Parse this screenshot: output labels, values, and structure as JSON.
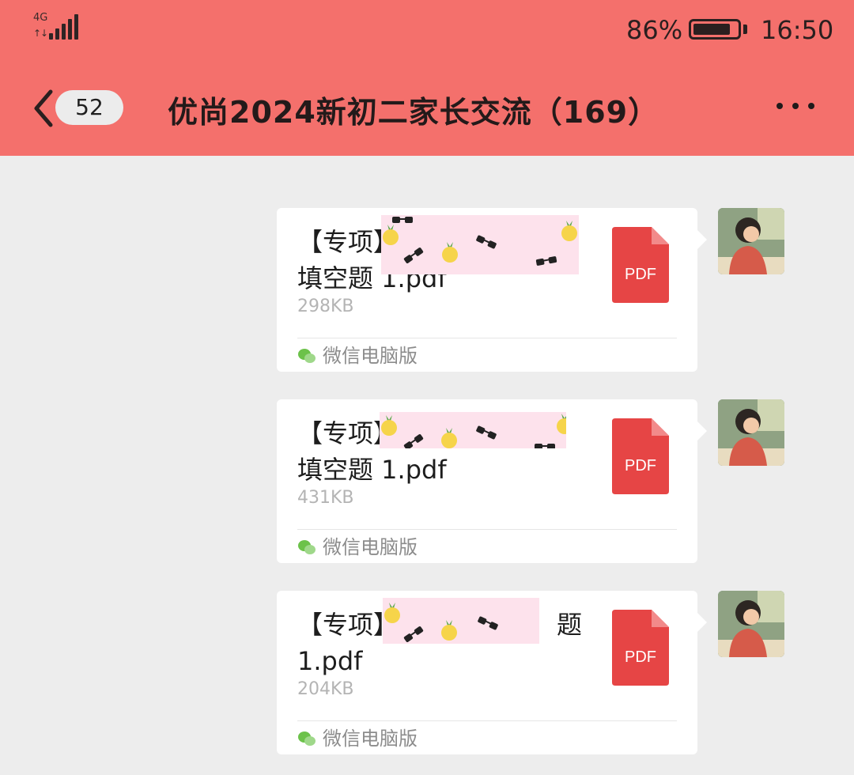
{
  "status_bar": {
    "network": "4G",
    "battery_percent": "86%",
    "battery_level": 0.86,
    "time": "16:50"
  },
  "nav": {
    "unread_count": "52",
    "title": "优尚2024新初二家长交流（169）"
  },
  "messages": [
    {
      "name_line1": "【专项】",
      "name_line2": "填空题 1.pdf",
      "size": "298KB",
      "source": "微信电脑版",
      "file_type": "PDF"
    },
    {
      "name_line1": "【专项】",
      "name_line2": "填空题 1.pdf",
      "size": "431KB",
      "source": "微信电脑版",
      "file_type": "PDF"
    },
    {
      "name_line1": "【专项】",
      "name_line1_tail": "题",
      "name_line2": "1.pdf",
      "size": "204KB",
      "source": "微信电脑版",
      "file_type": "PDF"
    }
  ],
  "colors": {
    "header_bg": "#f4706c",
    "chat_bg": "#ededed",
    "pdf_red": "#e64545",
    "redaction_pink": "#fde2ec"
  },
  "icons": {
    "back": "chevron-left-icon",
    "more": "more-dots-icon",
    "file": "pdf-file-icon",
    "source": "wechat-icon"
  }
}
